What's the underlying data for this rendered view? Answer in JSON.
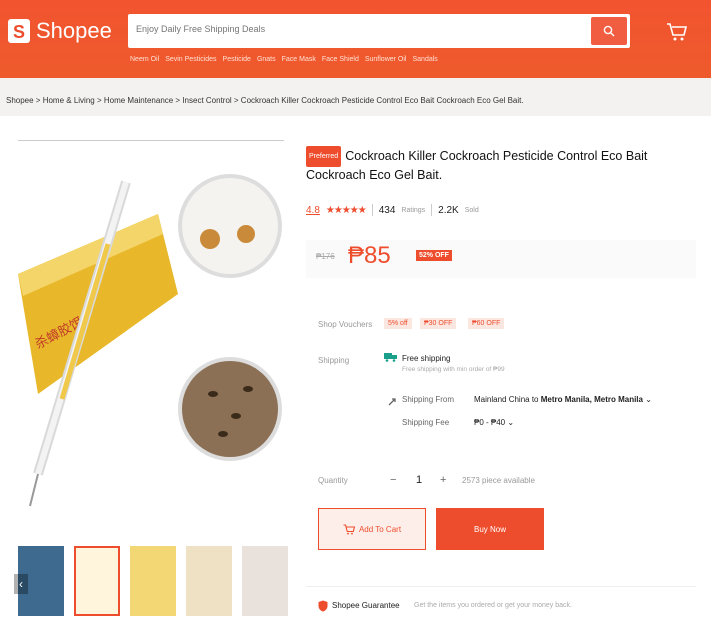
{
  "header": {
    "logo_text": "Shopee",
    "search_placeholder": "Enjoy Daily Free Shipping Deals",
    "keywords": [
      "Neem Oil",
      "Sevin Pesticides",
      "Pesticide",
      "Gnats",
      "Face Mask",
      "Face Shield",
      "Sunflower Oil",
      "Sandals"
    ]
  },
  "breadcrumb": "Shopee > Home & Living > Home Maintenance > Insect Control > Cockroach Killer Cockroach Pesticide Control Eco Bait Cockroach Eco Gel Bait.",
  "product": {
    "preferred_badge": "Preferred",
    "title": "Cockroach Killer Cockroach Pesticide Control Eco Bait Cockroach Eco Gel Bait.",
    "rating": "4.8",
    "stars": "★★★★★",
    "ratings_count": "434",
    "ratings_label": "Ratings",
    "sold_count": "2.2K",
    "sold_label": "Sold",
    "original_price": "₱176",
    "price": "₱85",
    "discount": "52% OFF"
  },
  "vouchers": {
    "label": "Shop Vouchers",
    "items": [
      "5% off",
      "₱30 OFF",
      "₱60 OFF"
    ]
  },
  "shipping": {
    "label": "Shipping",
    "free": "Free shipping",
    "free_note": "Free shipping with min order of ₱99",
    "from_label": "Shipping From",
    "from_origin": "Mainland China",
    "from_to": "to",
    "from_value": "Metro Manila, Metro Manila",
    "fee_label": "Shipping Fee",
    "fee_value": "₱0 - ₱40"
  },
  "quantity": {
    "label": "Quantity",
    "minus": "−",
    "value": "1",
    "plus": "+",
    "available": "2573 piece available"
  },
  "actions": {
    "add_to_cart": "Add To Cart",
    "buy_now": "Buy Now"
  },
  "guarantee": {
    "title": "Shopee Guarantee",
    "text": "Get the items you ordered or get your money back."
  },
  "colors": {
    "brand": "#ee4d2d"
  }
}
